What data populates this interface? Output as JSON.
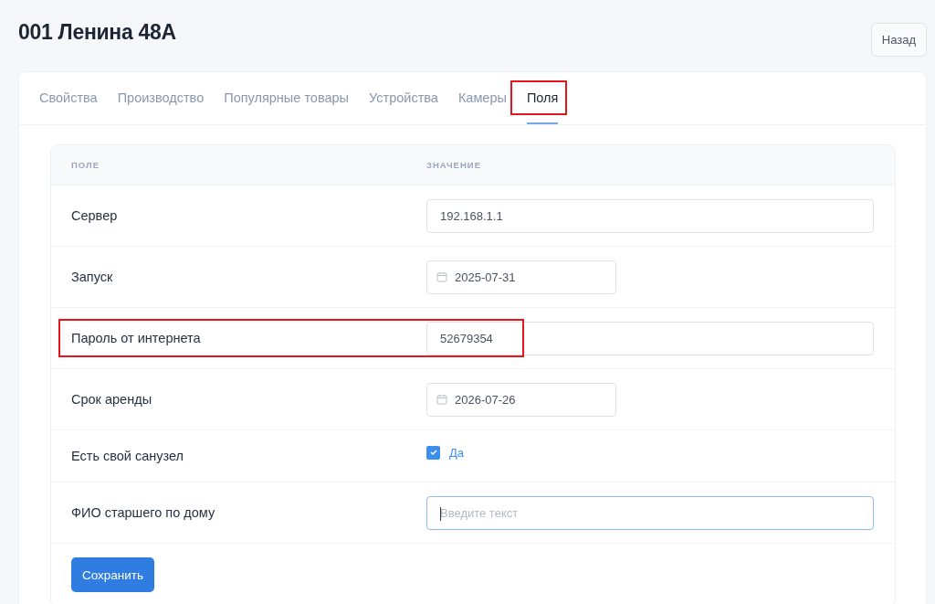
{
  "page": {
    "title": "001 Ленина 48А",
    "back_button": "Назад"
  },
  "tabs": [
    {
      "label": "Свойства",
      "selected": false,
      "highlighted": false
    },
    {
      "label": "Производство",
      "selected": false,
      "highlighted": false
    },
    {
      "label": "Популярные товары",
      "selected": false,
      "highlighted": false
    },
    {
      "label": "Устройства",
      "selected": false,
      "highlighted": false
    },
    {
      "label": "Камеры",
      "selected": false,
      "highlighted": false
    },
    {
      "label": "Поля",
      "selected": true,
      "highlighted": true
    }
  ],
  "table": {
    "columns": [
      "ПОЛЕ",
      "ЗНАЧЕНИЕ"
    ],
    "rows": [
      {
        "kind": "text",
        "label": "Сервер",
        "value": "192.168.1.1",
        "highlighted": false,
        "focused": false
      },
      {
        "kind": "date",
        "label": "Запуск",
        "value": "2025-07-31",
        "highlighted": false,
        "focused": false
      },
      {
        "kind": "text",
        "label": "Пароль от интернета",
        "value": "52679354",
        "highlighted": true,
        "focused": false
      },
      {
        "kind": "date",
        "label": "Срок аренды",
        "value": "2026-07-26",
        "highlighted": false,
        "focused": false
      },
      {
        "kind": "checkbox",
        "label": "Есть свой санузел",
        "value": "Да",
        "checked": true,
        "highlighted": false
      },
      {
        "kind": "text",
        "label": "ФИО старшего по дому",
        "placeholder": "Введите текст",
        "highlighted": false,
        "focused": true
      }
    ]
  },
  "save_button": "Сохранить"
}
